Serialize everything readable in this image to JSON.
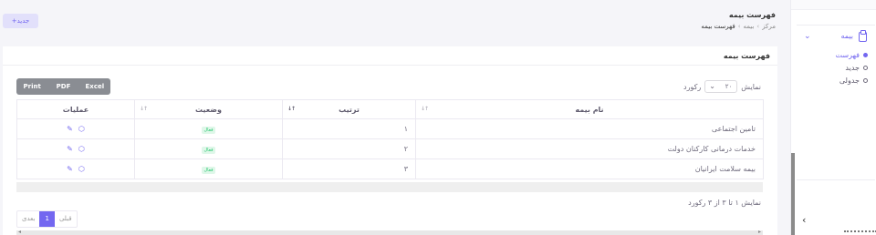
{
  "header": {
    "add_button": "+جدید",
    "title": "فهرست بیمه",
    "breadcrumb": [
      "مرکز",
      "بیمه",
      "فهرست بیمه"
    ]
  },
  "card": {
    "title": "فهرست بیمه",
    "export_buttons": [
      "Print",
      "PDF",
      "Excel"
    ],
    "length": {
      "prefix": "نمایش",
      "value": "۲۰",
      "suffix": "رکورد"
    },
    "columns": [
      "نام بیمه",
      "ترتیب",
      "وضعیت",
      "عملیات"
    ],
    "rows": [
      {
        "name": "تامین اجتماعی",
        "order": "۱",
        "status": "فعال"
      },
      {
        "name": "خدمات درمانی کارکنان دولت",
        "order": "۲",
        "status": "فعال"
      },
      {
        "name": "بیمه سلامت ایرانیان",
        "order": "۳",
        "status": "فعال"
      }
    ],
    "info": "نمایش ۱ تا ۳ از ۳ رکورد",
    "pager": {
      "prev": "قبلی",
      "page": "1",
      "next": "بعدی"
    }
  },
  "sidebar": {
    "menu_label": "بیمه",
    "items": [
      {
        "label": "فهرست",
        "active": true
      },
      {
        "label": "جدید",
        "active": false
      },
      {
        "label": "جدولی",
        "active": false
      }
    ]
  },
  "icons": {
    "edit": "pencil-icon",
    "view": "box-icon",
    "menu": "clipboard-icon",
    "chevron": "chevron-down-icon",
    "collapse": "chevron-left-icon"
  },
  "colors": {
    "accent": "#7367f0",
    "success": "#28c76f",
    "export": "#8a8d93"
  }
}
